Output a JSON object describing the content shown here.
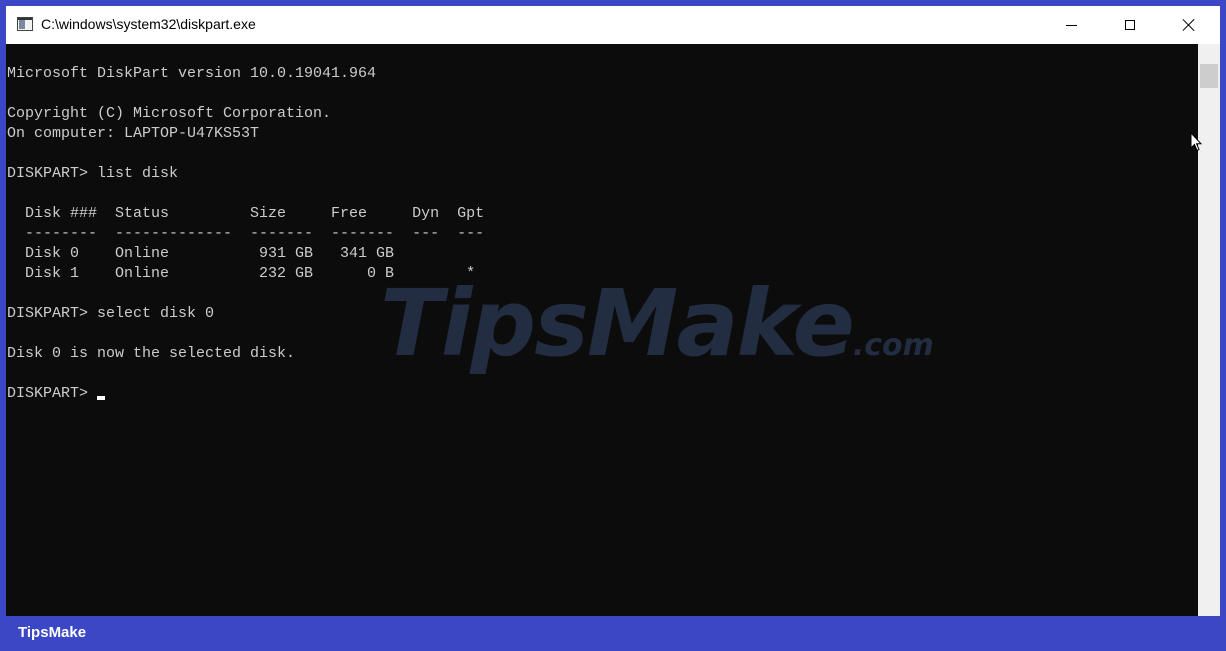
{
  "window": {
    "title": "C:\\windows\\system32\\diskpart.exe",
    "icon": "console-window-icon",
    "controls": {
      "minimize": "minimize-icon",
      "maximize": "maximize-icon",
      "close": "close-icon"
    }
  },
  "console": {
    "lines": [
      "Microsoft DiskPart version 10.0.19041.964",
      "",
      "Copyright (C) Microsoft Corporation.",
      "On computer: LAPTOP-U47KS53T",
      "",
      "DISKPART> list disk",
      "",
      "  Disk ###  Status         Size     Free     Dyn  Gpt",
      "  --------  -------------  -------  -------  ---  ---",
      "  Disk 0    Online          931 GB   341 GB",
      "  Disk 1    Online          232 GB      0 B        *",
      "",
      "DISKPART> select disk 0",
      "",
      "Disk 0 is now the selected disk.",
      ""
    ],
    "prompt": "DISKPART> ",
    "foreground": "#cccccc",
    "background": "#0c0c0c"
  },
  "watermark": {
    "text": "TipsMake",
    "suffix": ".com"
  },
  "brand": {
    "label": "TipsMake",
    "color": "#3b47c4"
  }
}
